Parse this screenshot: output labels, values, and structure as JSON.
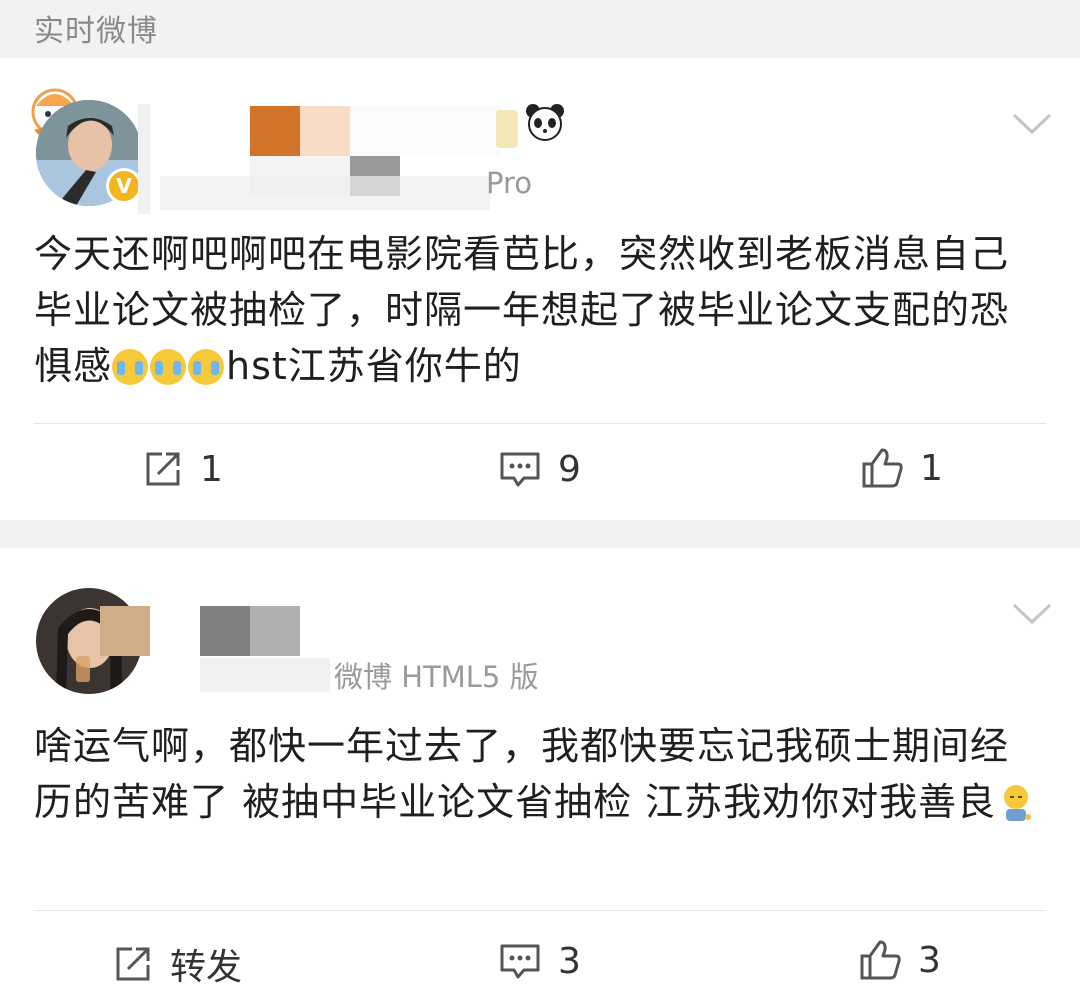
{
  "section": {
    "title": "实时微博"
  },
  "posts": [
    {
      "meta_tail": "Pro",
      "text_before_emoji": "今天还啊吧啊吧在电影院看芭比，突然收到老板消息自己毕业论文被抽检了，时隔一年想起了被毕业论文支配的恐惧感",
      "text_after_emoji": "hst江苏省你牛的",
      "emoji_names": [
        "cry-emoji",
        "cry-emoji",
        "cry-emoji"
      ],
      "actions": {
        "repost": "1",
        "comment": "9",
        "like": "1"
      }
    },
    {
      "meta_tail": "微博 HTML5 版",
      "text": "啥运气啊，都快一年过去了，我都快要忘记我硕士期间经历的苦难了 被抽中毕业论文省抽检 江苏我劝你对我善良",
      "actions": {
        "repost": "转发",
        "comment": "3",
        "like": "3"
      }
    }
  ],
  "colors": {
    "verified_badge": "#f5b521",
    "meta_gray": "#9a9a9a",
    "page_bg": "#f2f2f2"
  }
}
